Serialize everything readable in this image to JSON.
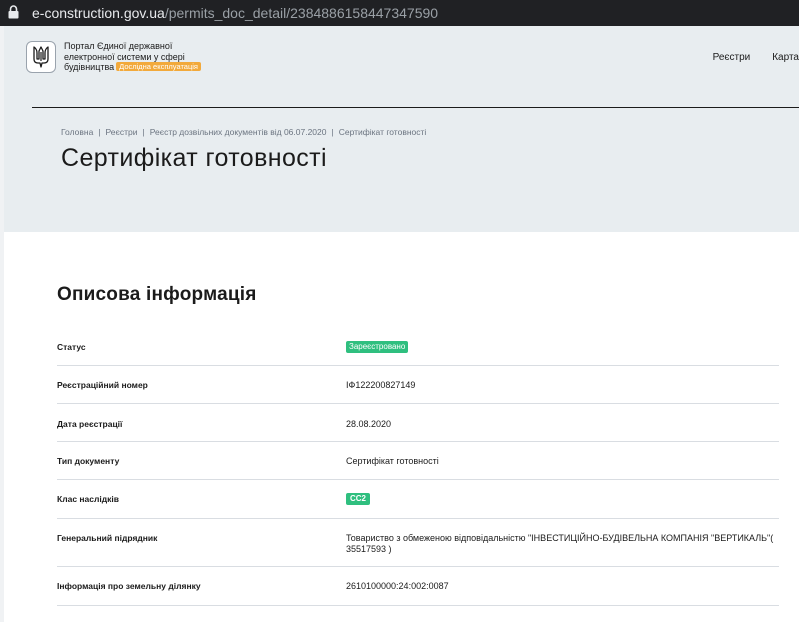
{
  "browser": {
    "domain": "e-construction.gov.ua",
    "path": "/permits_doc_detail/2384886158447347590"
  },
  "header": {
    "portal_line1": "Портал Єдиної державної",
    "portal_line2": "електронної системи у сфері",
    "portal_line3": "будівництва",
    "trial_badge": "Дослідна експлуатація",
    "nav": [
      "Реєстри",
      "Карта"
    ]
  },
  "breadcrumb": [
    "Головна",
    "Реєстри",
    "Реєстр дозвільних документів від 06.07.2020",
    "Сертифікат готовності"
  ],
  "page_title": "Сертифікат готовності",
  "section_title": "Описова інформація",
  "rows": [
    {
      "label": "Статус",
      "value": "Зареєстровано"
    },
    {
      "label": "Реєстраційний номер",
      "value": "ІФ122200827149"
    },
    {
      "label": "Дата реєстрації",
      "value": "28.08.2020"
    },
    {
      "label": "Тип документу",
      "value": "Сертифікат готовності"
    },
    {
      "label": "Клас наслідків",
      "value": "СС2"
    },
    {
      "label": "Генеральний підрядник",
      "value": "Товариство з обмеженою відповідальністю \"ІНВЕСТИЦІЙНО-БУДІВЕЛЬНА КОМПАНІЯ \"ВЕРТИКАЛЬ\"( 35517593 )"
    },
    {
      "label": "Інформація про земельну ділянку",
      "value": "2610100000:24:002:0087"
    }
  ],
  "colors": {
    "header_bg": "#e8edf0",
    "status_green": "#2fbf7f",
    "trial_orange": "#f2a93b"
  }
}
